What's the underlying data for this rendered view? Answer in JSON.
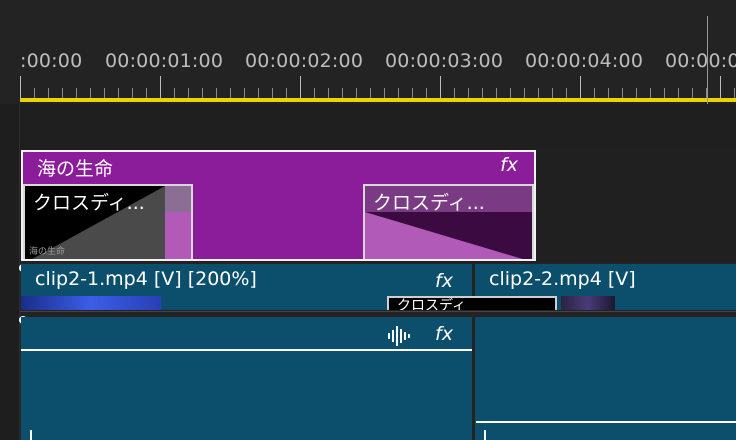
{
  "ruler": {
    "timecodes": [
      ":00:00",
      "00:00:01:00",
      "00:00:02:00",
      "00:00:03:00",
      "00:00:04:00",
      "00:00:0"
    ]
  },
  "nested_clip": {
    "title": "海の生命",
    "fx": "fx",
    "transition_left": "クロスディ...",
    "transition_right": "クロスディ...",
    "thumb_label": "海の生命",
    "color": "#8b1c9a"
  },
  "video_clips": [
    {
      "title": "clip2-1.mp4 [V] [200%]",
      "fx": "fx"
    },
    {
      "title": "clip2-2.mp4 [V]"
    }
  ],
  "overlap_transition": "クロスディ",
  "audio_clip": {
    "fx": "fx",
    "waveform_icon": "audio-waveform-icon"
  },
  "colors": {
    "playhead_bar": "#e9d400",
    "video_clip": "#0b4f6c",
    "nested_clip": "#8b1c9a"
  }
}
